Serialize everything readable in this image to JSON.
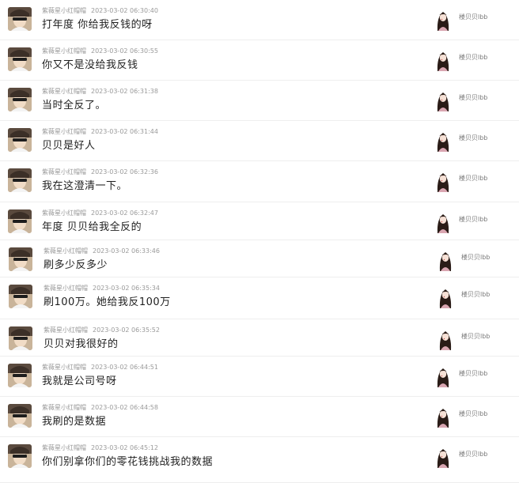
{
  "messages": [
    {
      "sender": "紫薇星小红帽帽",
      "time": "2023-03-02 06:30:40",
      "text": "打年度  你给我反钱的呀",
      "recipient": "楼贝贝lbb"
    },
    {
      "sender": "紫薇星小红帽帽",
      "time": "2023-03-02 06:30:55",
      "text": "你又不是没给我反钱",
      "recipient": "楼贝贝lbb"
    },
    {
      "sender": "紫薇星小红帽帽",
      "time": "2023-03-02 06:31:38",
      "text": "当时全反了。",
      "recipient": "楼贝贝lbb"
    },
    {
      "sender": "紫薇星小红帽帽",
      "time": "2023-03-02 06:31:44",
      "text": "贝贝是好人",
      "recipient": "楼贝贝lbb"
    },
    {
      "sender": "紫薇星小红帽帽",
      "time": "2023-03-02 06:32:36",
      "text": "我在这澄清一下。",
      "recipient": "楼贝贝lbb"
    },
    {
      "sender": "紫薇星小红帽帽",
      "time": "2023-03-02 06:32:47",
      "text": "年度  贝贝给我全反的",
      "recipient": "楼贝贝lbb"
    },
    {
      "sender": "紫薇星小红帽帽",
      "time": "2023-03-02 06:33:46",
      "text": "刷多少反多少",
      "recipient": "楼贝贝lbb"
    },
    {
      "sender": "紫薇星小红帽帽",
      "time": "2023-03-02 06:35:34",
      "text": "刷100万。她给我反100万",
      "recipient": "楼贝贝lbb"
    },
    {
      "sender": "紫薇星小红帽帽",
      "time": "2023-03-02 06:35:52",
      "text": "贝贝对我很好的",
      "recipient": "楼贝贝lbb"
    },
    {
      "sender": "紫薇星小红帽帽",
      "time": "2023-03-02 06:44:51",
      "text": "我就是公司号呀",
      "recipient": "楼贝贝lbb"
    },
    {
      "sender": "紫薇星小红帽帽",
      "time": "2023-03-02 06:44:58",
      "text": "我刷的是数据",
      "recipient": "楼贝贝lbb"
    },
    {
      "sender": "紫薇星小红帽帽",
      "time": "2023-03-02 06:45:12",
      "text": "你们别拿你们的零花钱挑战我的数据",
      "recipient": "楼贝贝lbb"
    }
  ],
  "icons": {
    "sender_avatar": "sender-avatar-icon",
    "recipient_avatar": "recipient-avatar-icon"
  },
  "colors": {
    "meta_text": "#9a9a9a",
    "message_text": "#1f1f1f",
    "divider": "#eeeeee"
  }
}
